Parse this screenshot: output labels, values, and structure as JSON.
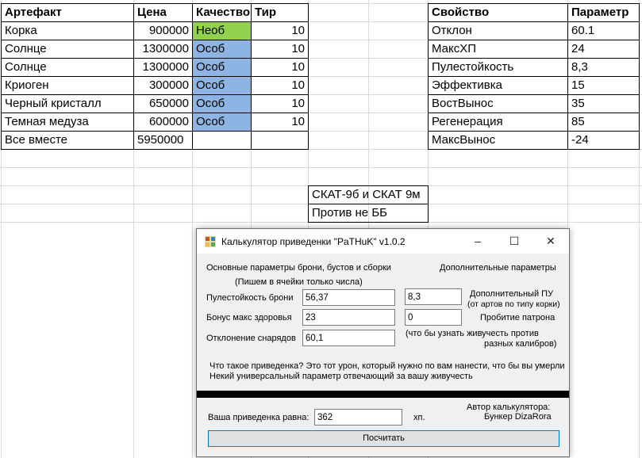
{
  "sheet": {
    "artifacts": {
      "headers": [
        "Артефакт",
        "Цена",
        "Качество",
        "Тир"
      ],
      "rows": [
        {
          "name": "Корка",
          "price": "900000",
          "quality": "Необ",
          "tier": "10"
        },
        {
          "name": "Солнце",
          "price": "1300000",
          "quality": "Особ",
          "tier": "10"
        },
        {
          "name": "Солнце",
          "price": "1300000",
          "quality": "Особ",
          "tier": "10"
        },
        {
          "name": "Криоген",
          "price": "300000",
          "quality": "Особ",
          "tier": "10"
        },
        {
          "name": "Черный кристалл",
          "price": "650000",
          "quality": "Особ",
          "tier": "10"
        },
        {
          "name": "Темная медуза",
          "price": "600000",
          "quality": "Особ",
          "tier": "10"
        }
      ],
      "total_label": "Все вместе",
      "total_value": "5950000"
    },
    "properties": {
      "headers": [
        "Свойство",
        "Параметр"
      ],
      "rows": [
        {
          "name": "Отклон",
          "value": "60.1"
        },
        {
          "name": "МаксХП",
          "value": "24"
        },
        {
          "name": "Пулестойкость",
          "value": "8,3"
        },
        {
          "name": "Эффективка",
          "value": "15"
        },
        {
          "name": "ВостВынос",
          "value": "35"
        },
        {
          "name": "Регенерация",
          "value": "85"
        },
        {
          "name": "МаксВынос",
          "value": "-24"
        }
      ]
    },
    "note": {
      "line1": "СКАТ-9б и СКАТ 9м",
      "line2": "Против не ББ"
    },
    "colors": {
      "quality_neob": "#92d050",
      "quality_osob": "#8db4e2"
    }
  },
  "window": {
    "title": "Калькулятор приведенки \"PaTHuK\" v1.0.2",
    "controls": {
      "minimize": "–",
      "maximize": "☐",
      "close": "✕"
    },
    "main_params_title": "Основные параметры брони, бустов и сборки",
    "main_params_hint": "(Пишем в ячейки только числа)",
    "extra_params_title": "Дополнительные параметры",
    "fields": {
      "bullet_resist": {
        "label": "Пулестойкость брони",
        "value": "56,37"
      },
      "max_health_bonus": {
        "label": "Бонус макс здоровья",
        "value": "23"
      },
      "deflection": {
        "label": "Отклонение снарядов",
        "value": "60,1"
      },
      "extra_pu": {
        "label_line1": "Дополнительный ПУ",
        "label_line2": "(от артов по типу корки)",
        "value": "8,3"
      },
      "penetration": {
        "label": "Пробитие патрона",
        "value": "0"
      }
    },
    "caliber_hint_line1": "(что бы узнать живучесть против",
    "caliber_hint_line2": "разных калибров)",
    "explain_line1": "Что такое приведенка? Это тот урон, который нужно по вам нанести, что бы вы умерли",
    "explain_line2": "Некий универсальный параметр отвечающий за вашу живучесть",
    "author_line1": "Автор калькулятора:",
    "author_line2": "Бункер DizaRora",
    "result_label": "Ваша приведенка равна:",
    "result_value": "362",
    "result_unit": "хп.",
    "calc_button": "Посчитать"
  }
}
